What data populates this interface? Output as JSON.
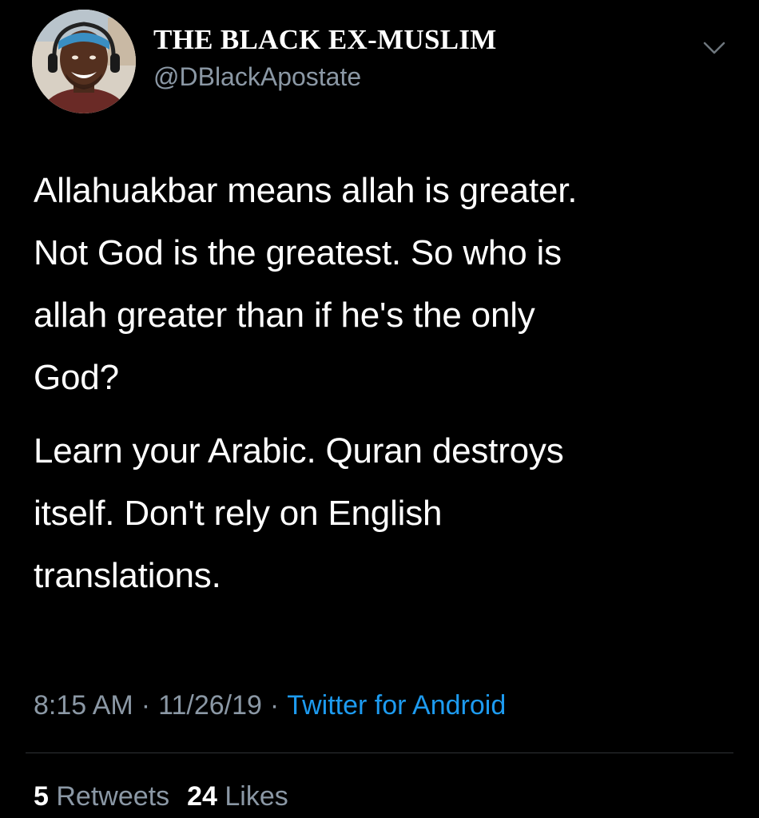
{
  "author": {
    "display_name": "THE BLACK EX-MUSLIM",
    "handle": "@DBlackApostate",
    "avatar_icon": "profile-photo-headphones"
  },
  "menu": {
    "icon": "chevron-down-icon"
  },
  "tweet": {
    "paragraphs": [
      "Allahuakbar means allah is greater.\nNot God is the greatest. So who is\nallah greater than if he's the only\nGod?",
      "Learn your Arabic. Quran destroys\nitself. Don't rely on English\ntranslations."
    ]
  },
  "meta": {
    "time": "8:15 AM",
    "separator": "·",
    "date": "11/26/19",
    "source": "Twitter for Android"
  },
  "stats": {
    "retweets_count": "5",
    "retweets_label": "Retweets",
    "likes_count": "24",
    "likes_label": "Likes"
  },
  "colors": {
    "background": "#000000",
    "text": "#ffffff",
    "secondary_text": "#8b98a5",
    "link": "#1d9bf0",
    "divider": "#2f3336"
  }
}
